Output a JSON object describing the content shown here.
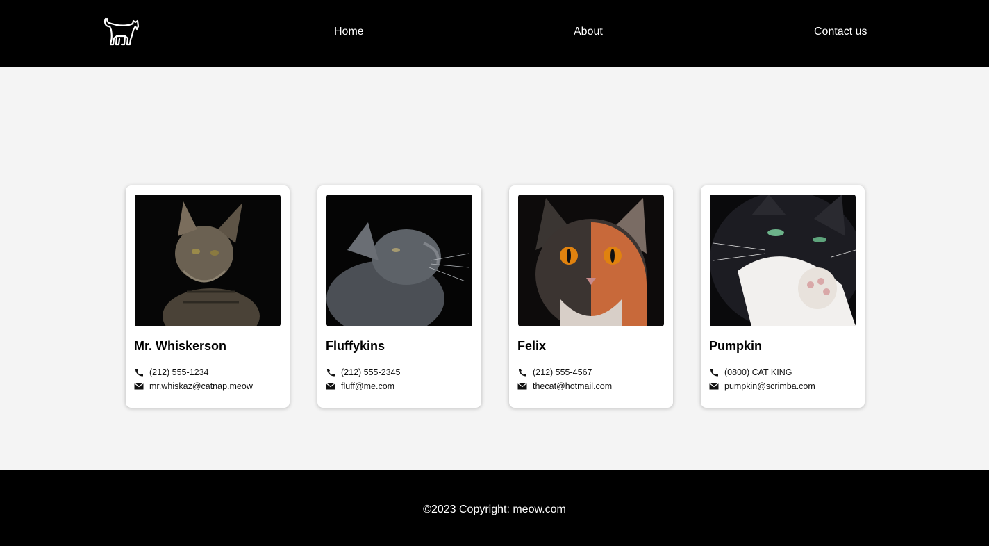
{
  "header": {
    "logo_icon": "cat-icon",
    "nav": {
      "home": "Home",
      "about": "About",
      "contact": "Contact us"
    }
  },
  "cards": [
    {
      "name": "Mr. Whiskerson",
      "phone": "(212) 555-1234",
      "email": "mr.whiskaz@catnap.meow",
      "photo_icon": "tabby-cat-photo"
    },
    {
      "name": "Fluffykins",
      "phone": "(212) 555-2345",
      "email": "fluff@me.com",
      "photo_icon": "grey-cat-photo"
    },
    {
      "name": "Felix",
      "phone": "(212) 555-4567",
      "email": "thecat@hotmail.com",
      "photo_icon": "calico-cat-photo"
    },
    {
      "name": "Pumpkin",
      "phone": "(0800) CAT KING",
      "email": "pumpkin@scrimba.com",
      "photo_icon": "black-white-cat-photo"
    }
  ],
  "footer": {
    "copyright": "©2023 Copyright: meow.com"
  },
  "colors": {
    "header_bg": "#000000",
    "page_bg": "#f4f4f4",
    "card_bg": "#ffffff",
    "text_light": "#ffffff"
  }
}
